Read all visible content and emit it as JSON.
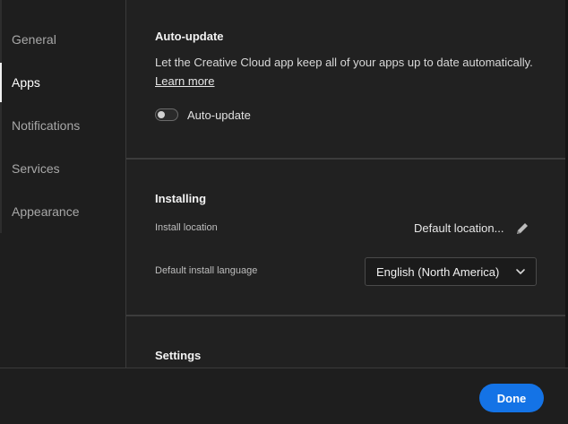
{
  "sidebar": {
    "items": [
      {
        "label": "General",
        "active": false
      },
      {
        "label": "Apps",
        "active": true
      },
      {
        "label": "Notifications",
        "active": false
      },
      {
        "label": "Services",
        "active": false
      },
      {
        "label": "Appearance",
        "active": false
      }
    ]
  },
  "auto_update": {
    "heading": "Auto-update",
    "description": "Let the Creative Cloud app keep all of your apps up to date automatically.",
    "learn_more": "Learn more",
    "toggle_label": "Auto-update",
    "toggle_on": false
  },
  "installing": {
    "heading": "Installing",
    "install_location_label": "Install location",
    "install_location_value": "Default location...",
    "language_label": "Default install language",
    "language_value": "English (North America)"
  },
  "settings": {
    "heading": "Settings"
  },
  "footer": {
    "done_label": "Done"
  },
  "colors": {
    "accent": "#1473e6",
    "background": "#1e1e1e",
    "panel": "#212121"
  },
  "icons": {
    "edit": "pencil-icon",
    "dropdown": "chevron-down-icon"
  }
}
